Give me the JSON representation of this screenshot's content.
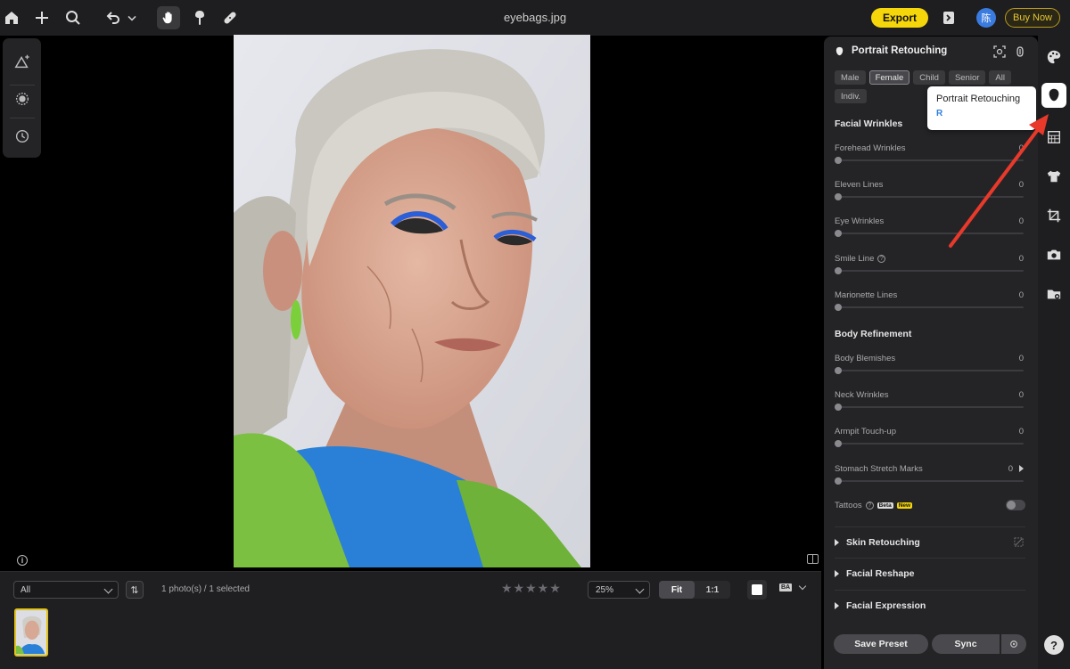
{
  "topbar": {
    "filename": "eyebags.jpg",
    "export_label": "Export",
    "avatar_char": "陈",
    "buy_label": "Buy Now"
  },
  "filmstrip": {
    "filter_value": "All",
    "sort_glyph": "⇅",
    "photo_count": "1 photo(s) / 1 selected",
    "stars": "★★★★★",
    "zoom_value": "25%",
    "fit_label": "Fit",
    "one_to_one_label": "1:1",
    "ba_label": "BA"
  },
  "panel": {
    "title": "Portrait Retouching",
    "tags": [
      {
        "label": "Male",
        "active": false
      },
      {
        "label": "Female",
        "active": true
      },
      {
        "label": "Child",
        "active": false
      },
      {
        "label": "Senior",
        "active": false
      },
      {
        "label": "All",
        "active": false
      },
      {
        "label": "Indiv.",
        "active": false
      }
    ],
    "facial_wrinkles_title": "Facial Wrinkles",
    "facial_wrinkles": [
      {
        "label": "Forehead Wrinkles",
        "value": "0"
      },
      {
        "label": "Eleven Lines",
        "value": "0"
      },
      {
        "label": "Eye Wrinkles",
        "value": "0"
      },
      {
        "label": "Smile Line",
        "value": "0"
      },
      {
        "label": "Marionette Lines",
        "value": "0"
      }
    ],
    "body_refinement_title": "Body Refinement",
    "body_refinement": [
      {
        "label": "Body Blemishes",
        "value": "0"
      },
      {
        "label": "Neck Wrinkles",
        "value": "0"
      },
      {
        "label": "Armpit Touch-up",
        "value": "0"
      },
      {
        "label": "Stomach Stretch Marks",
        "value": "0"
      }
    ],
    "tattoos_label": "Tattoos",
    "tattoos_enabled": false,
    "beta_badge": "Beta",
    "new_badge": "New",
    "collapsed_sections": [
      "Skin Retouching",
      "Facial Reshape",
      "Facial Expression"
    ],
    "save_preset_label": "Save Preset",
    "sync_label": "Sync",
    "help_label": "?"
  },
  "tooltip": {
    "title": "Portrait Retouching",
    "shortcut": "R"
  },
  "colors": {
    "accent_yellow": "#f5d60a",
    "link_blue": "#2f7fe0",
    "annotation_red": "#e8392b"
  }
}
